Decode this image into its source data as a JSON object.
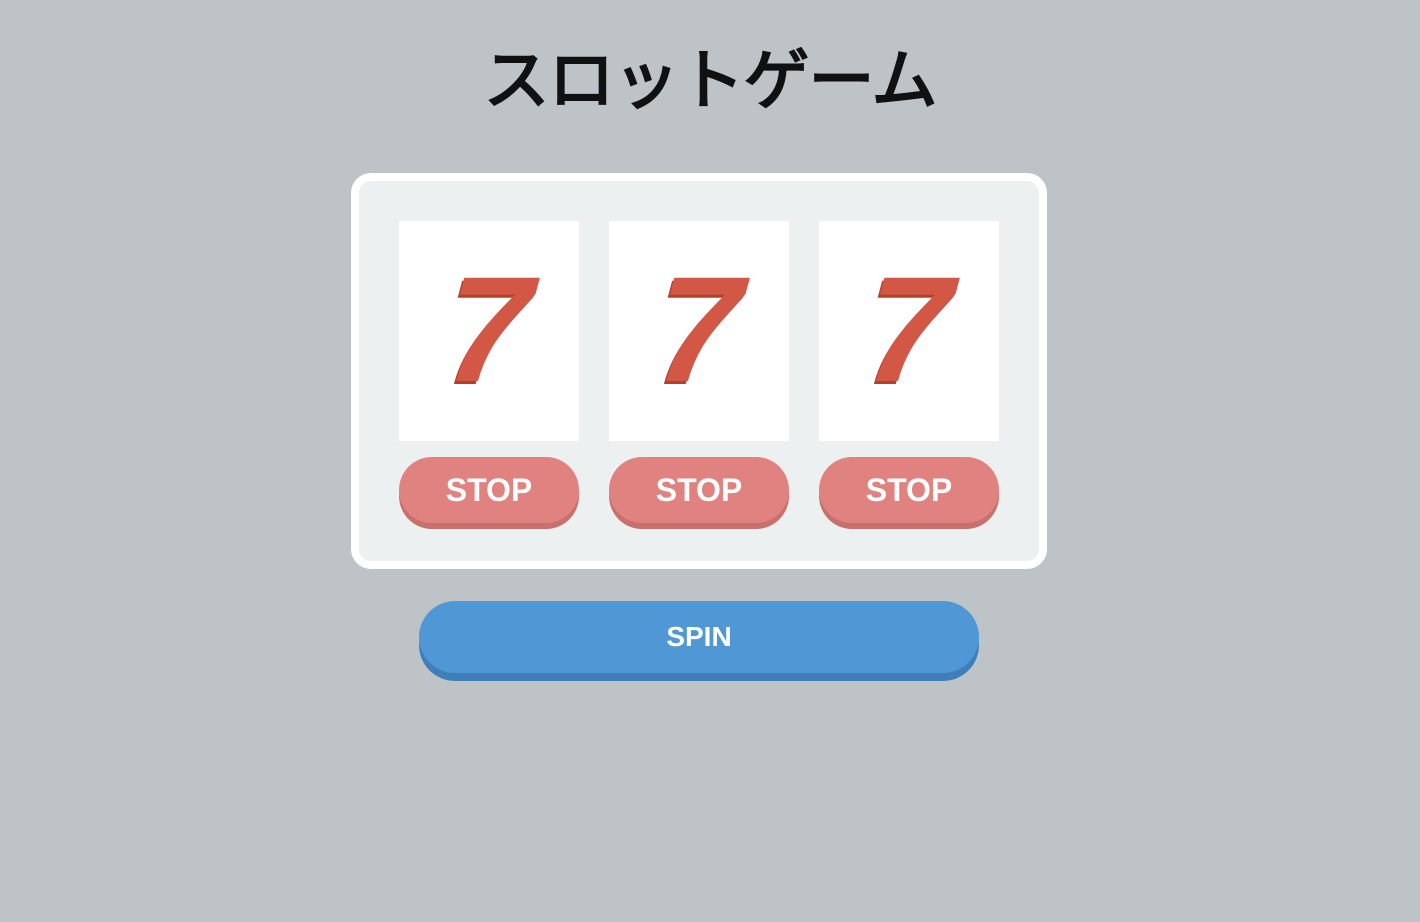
{
  "title": "スロットゲーム",
  "reels": [
    {
      "symbol": "7",
      "stop_label": "STOP"
    },
    {
      "symbol": "7",
      "stop_label": "STOP"
    },
    {
      "symbol": "7",
      "stop_label": "STOP"
    }
  ],
  "spin_label": "SPIN",
  "colors": {
    "background": "#bdc3c7",
    "machine": "#ecf0f1",
    "symbol": "#d35745",
    "stop_button": "#e08280",
    "spin_button": "#5098d5"
  }
}
